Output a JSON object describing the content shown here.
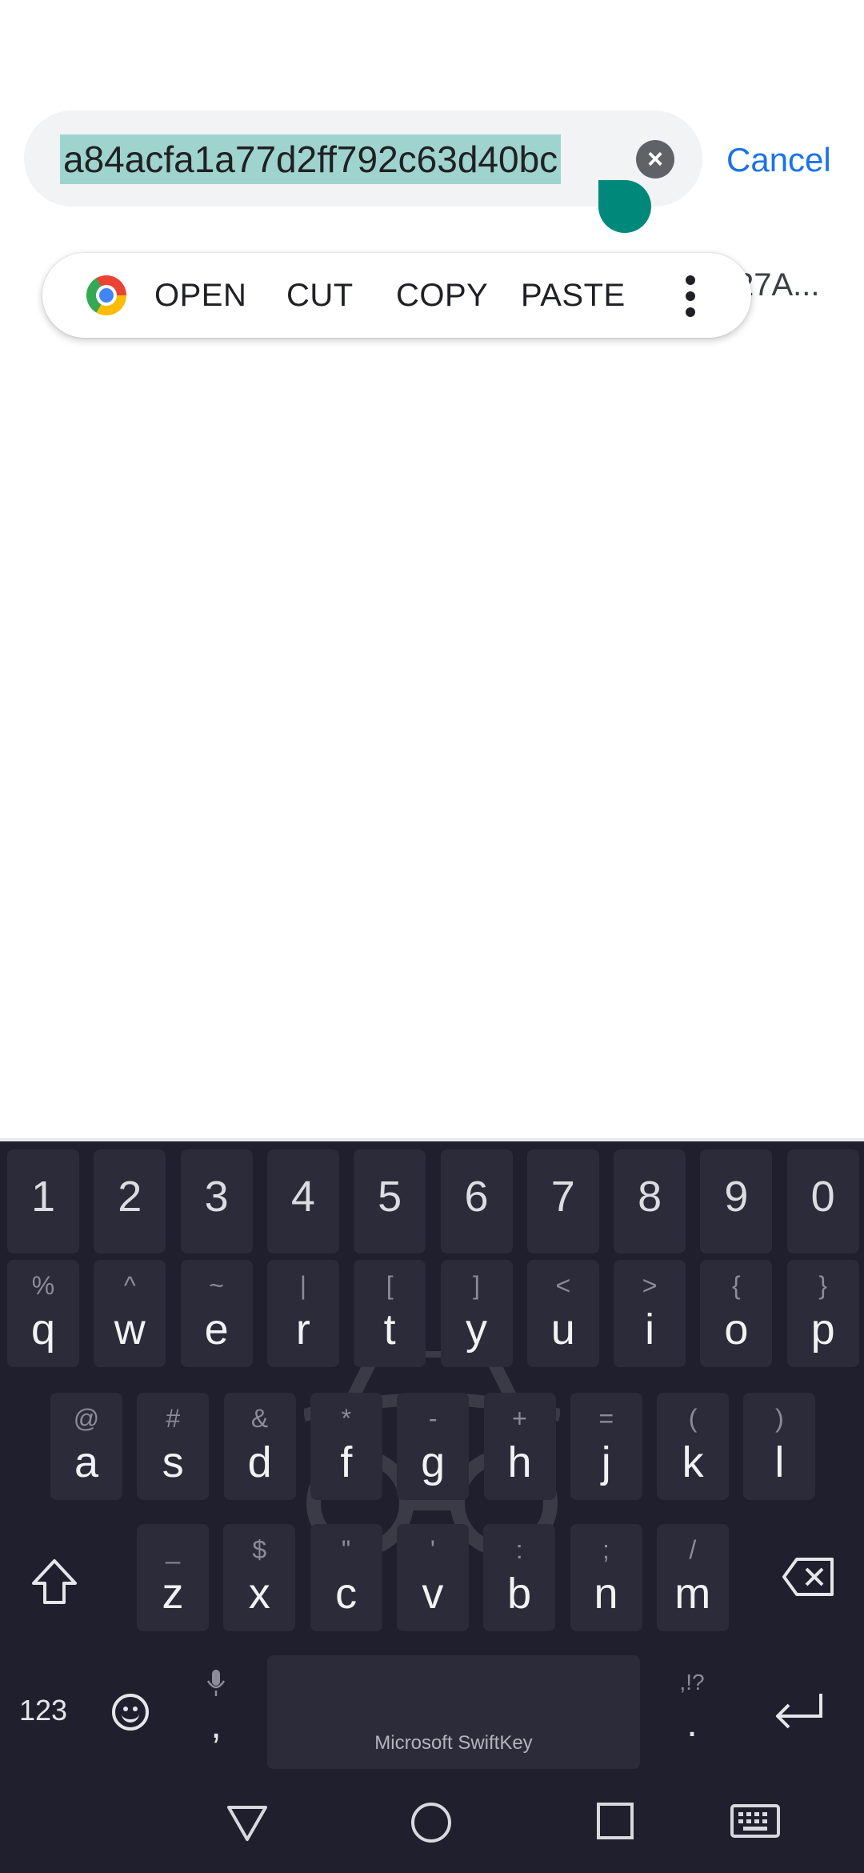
{
  "search": {
    "query": "a84acfa1a77d2ff792c63d40bc",
    "cancel_label": "Cancel",
    "clear_icon": "close-circle-icon"
  },
  "suggestion_fragment": "27A...",
  "selection_toolbar": {
    "open_label": "OPEN",
    "cut_label": "CUT",
    "copy_label": "COPY",
    "paste_label": "PASTE",
    "app_icon": "chrome-icon",
    "more_icon": "more-vertical-icon"
  },
  "keyboard": {
    "numbers": [
      "1",
      "2",
      "3",
      "4",
      "5",
      "6",
      "7",
      "8",
      "9",
      "0"
    ],
    "row1": [
      {
        "key": "q",
        "alt": "%"
      },
      {
        "key": "w",
        "alt": "^"
      },
      {
        "key": "e",
        "alt": "~"
      },
      {
        "key": "r",
        "alt": "|"
      },
      {
        "key": "t",
        "alt": "["
      },
      {
        "key": "y",
        "alt": "]"
      },
      {
        "key": "u",
        "alt": "<"
      },
      {
        "key": "i",
        "alt": ">"
      },
      {
        "key": "o",
        "alt": "{"
      },
      {
        "key": "p",
        "alt": "}"
      }
    ],
    "row2": [
      {
        "key": "a",
        "alt": "@"
      },
      {
        "key": "s",
        "alt": "#"
      },
      {
        "key": "d",
        "alt": "&"
      },
      {
        "key": "f",
        "alt": "*"
      },
      {
        "key": "g",
        "alt": "-"
      },
      {
        "key": "h",
        "alt": "+"
      },
      {
        "key": "j",
        "alt": "="
      },
      {
        "key": "k",
        "alt": "("
      },
      {
        "key": "l",
        "alt": ")"
      }
    ],
    "row3": [
      {
        "key": "z",
        "alt": "_"
      },
      {
        "key": "x",
        "alt": "$"
      },
      {
        "key": "c",
        "alt": "\""
      },
      {
        "key": "v",
        "alt": "'"
      },
      {
        "key": "b",
        "alt": ":"
      },
      {
        "key": "n",
        "alt": ";"
      },
      {
        "key": "m",
        "alt": "/"
      }
    ],
    "numbers_toggle": "123",
    "comma": ",",
    "period": ".",
    "period_alt": ",!?",
    "space_label": "Microsoft SwiftKey",
    "accent_color": "#00897b"
  }
}
